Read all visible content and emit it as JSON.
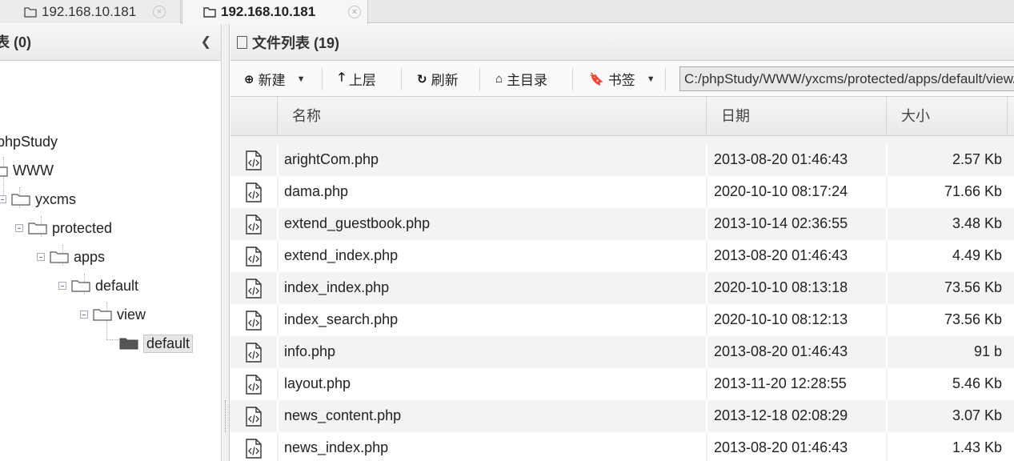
{
  "tabs": [
    {
      "label": "192.168.10.181",
      "active": false
    },
    {
      "label": "192.168.10.181",
      "active": true
    }
  ],
  "left_panel": {
    "title": "表 (0)",
    "tree": [
      {
        "label": "phpStudy"
      },
      {
        "label": "WWW"
      },
      {
        "label": "yxcms"
      },
      {
        "label": "protected"
      },
      {
        "label": "apps"
      },
      {
        "label": "default"
      },
      {
        "label": "view"
      },
      {
        "label": "default",
        "selected": true
      }
    ]
  },
  "right_panel": {
    "title": "文件列表 (19)",
    "toolbar": {
      "new_label": "新建",
      "up_label": "上层",
      "refresh_label": "刷新",
      "home_label": "主目录",
      "bookmark_label": "书签",
      "path": "C:/phpStudy/WWW/yxcms/protected/apps/default/view/default/"
    },
    "columns": {
      "name": "名称",
      "date": "日期",
      "size": "大小"
    },
    "files": [
      {
        "name": "arightCom.php",
        "date": "2013-08-20 01:46:43",
        "size": "2.57 Kb"
      },
      {
        "name": "dama.php",
        "date": "2020-10-10 08:17:24",
        "size": "71.66 Kb"
      },
      {
        "name": "extend_guestbook.php",
        "date": "2013-10-14 02:36:55",
        "size": "3.48 Kb"
      },
      {
        "name": "extend_index.php",
        "date": "2013-08-20 01:46:43",
        "size": "4.49 Kb"
      },
      {
        "name": "index_index.php",
        "date": "2020-10-10 08:13:18",
        "size": "73.56 Kb"
      },
      {
        "name": "index_search.php",
        "date": "2020-10-10 08:12:13",
        "size": "73.56 Kb"
      },
      {
        "name": "info.php",
        "date": "2013-08-20 01:46:43",
        "size": "91 b"
      },
      {
        "name": "layout.php",
        "date": "2013-11-20 12:28:55",
        "size": "5.46 Kb"
      },
      {
        "name": "news_content.php",
        "date": "2013-12-18 02:08:29",
        "size": "3.07 Kb"
      },
      {
        "name": "news_index.php",
        "date": "2013-08-20 01:46:43",
        "size": "1.43 Kb"
      }
    ]
  },
  "icons": {
    "tab": "folder-outline-icon",
    "file": "php-file-icon",
    "folder_open": "folder-outline-icon",
    "folder_selected": "folder-filled-icon"
  }
}
